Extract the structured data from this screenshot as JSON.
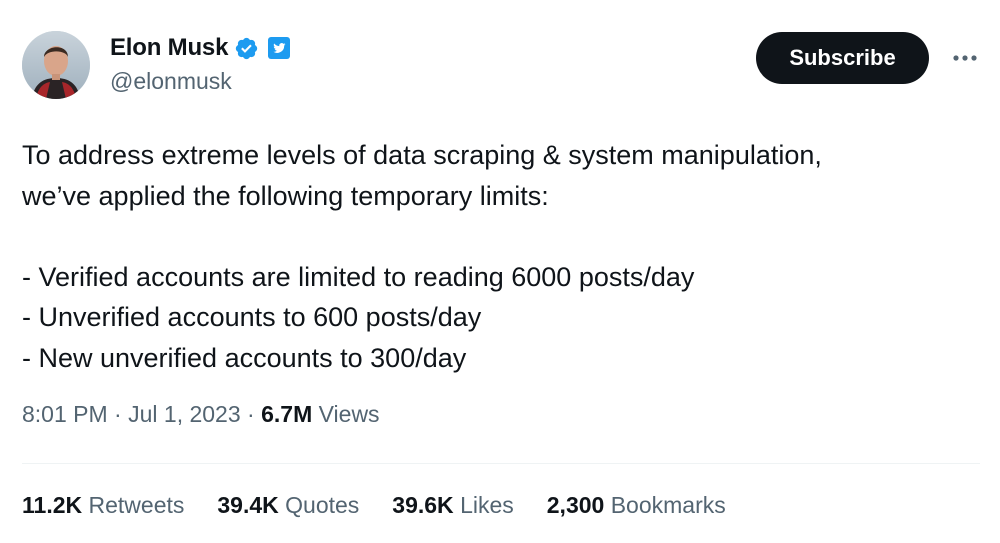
{
  "author": {
    "name": "Elon Musk",
    "handle": "@elonmusk",
    "avatar_icon": "profile-photo",
    "verified_color": "#1d9bf0",
    "affiliate_badge": "twitter-bird-icon"
  },
  "actions": {
    "subscribe_label": "Subscribe",
    "more_icon": "more-options-icon"
  },
  "tweet": {
    "lines": [
      "To address extreme levels of data scraping & system manipulation,",
      "we’ve applied the following temporary limits:",
      "",
      "- Verified accounts are limited to reading 6000 posts/day",
      "- Unverified accounts to 600 posts/day",
      "- New unverified accounts to 300/day"
    ]
  },
  "meta": {
    "time": "8:01 PM",
    "separator": "·",
    "date": "Jul 1, 2023",
    "views_count": "6.7M",
    "views_label": "Views"
  },
  "stats": {
    "retweets_count": "11.2K",
    "retweets_label": "Retweets",
    "quotes_count": "39.4K",
    "quotes_label": "Quotes",
    "likes_count": "39.6K",
    "likes_label": "Likes",
    "bookmarks_count": "2,300",
    "bookmarks_label": "Bookmarks"
  },
  "colors": {
    "text_primary": "#0f1419",
    "text_secondary": "#536471",
    "accent": "#1d9bf0",
    "button_bg": "#0f1419"
  }
}
